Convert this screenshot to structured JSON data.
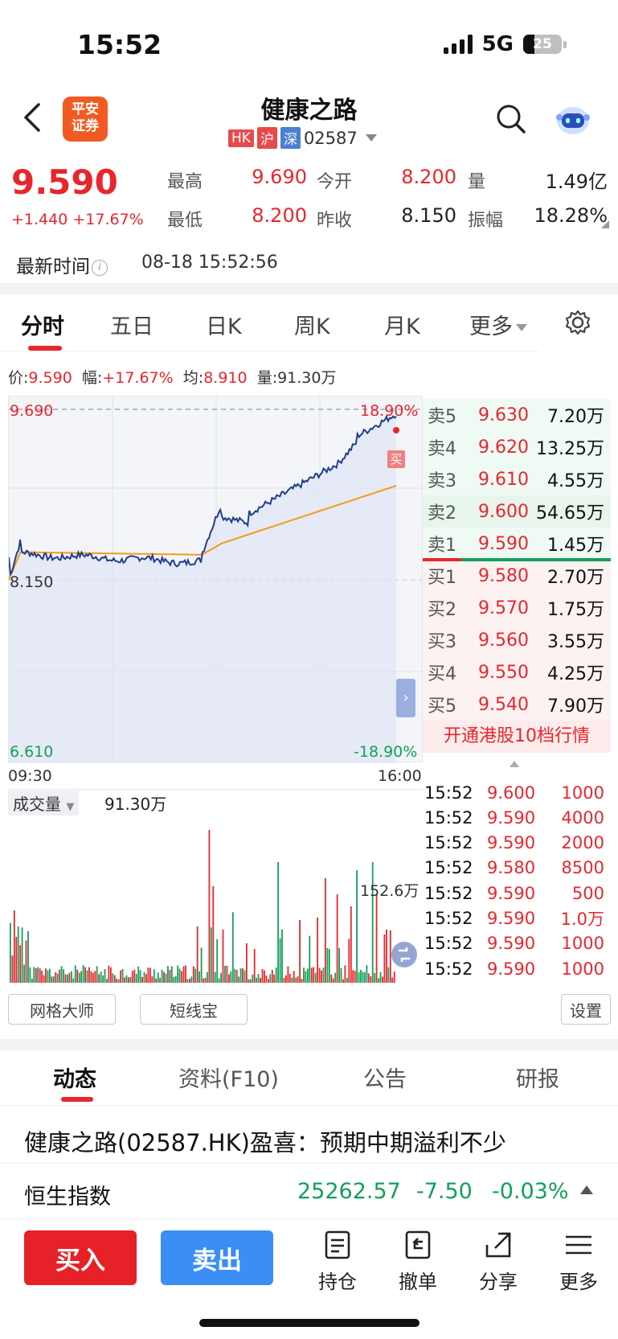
{
  "status": {
    "time": "15:52",
    "network": "5G",
    "battery": "25"
  },
  "header": {
    "logo_line1": "平安",
    "logo_line2": "证券",
    "title": "健康之路",
    "tags": [
      "HK",
      "沪",
      "深"
    ],
    "code": "02587"
  },
  "quote": {
    "price": "9.590",
    "change": "+1.440 +17.67%",
    "high_label": "最高",
    "high": "9.690",
    "open_label": "今开",
    "open": "8.200",
    "vol_label": "量",
    "volume": "1.49亿",
    "low_label": "最低",
    "low": "8.200",
    "prev_label": "昨收",
    "prev_close": "8.150",
    "amp_label": "振幅",
    "amplitude": "18.28%",
    "time_label": "最新时间",
    "time_value": "08-18 15:52:56"
  },
  "chart_tabs": [
    "分时",
    "五日",
    "日K",
    "周K",
    "月K",
    "更多"
  ],
  "stat_line": {
    "price_label": "价:",
    "price": "9.590",
    "pct_label": "幅:",
    "pct": "+17.67%",
    "avg_label": "均:",
    "avg": "8.910",
    "vol_label": "量:",
    "vol": "91.30万"
  },
  "chart_labels": {
    "top_left": "9.690",
    "top_right": "18.90%",
    "mid_left": "8.150",
    "bottom_left": "6.610",
    "bottom_right": "-18.90%",
    "time_start": "09:30",
    "time_end": "16:00",
    "buy_marker": "买",
    "vol_label": "成交量",
    "vol_value": "91.30万",
    "vol_peak": "152.6万"
  },
  "colors": {
    "red": "#e8262c",
    "green": "#12a05a",
    "blue": "#3a8ef5",
    "price_line": "#1f3e8c",
    "avg_line": "#f39a1d"
  },
  "order_book": {
    "asks": [
      {
        "label": "卖5",
        "price": "9.630",
        "vol": "7.20万"
      },
      {
        "label": "卖4",
        "price": "9.620",
        "vol": "13.25万"
      },
      {
        "label": "卖3",
        "price": "9.610",
        "vol": "4.55万"
      },
      {
        "label": "卖2",
        "price": "9.600",
        "vol": "54.65万"
      },
      {
        "label": "卖1",
        "price": "9.590",
        "vol": "1.45万"
      }
    ],
    "bids": [
      {
        "label": "买1",
        "price": "9.580",
        "vol": "2.70万"
      },
      {
        "label": "买2",
        "price": "9.570",
        "vol": "1.75万"
      },
      {
        "label": "买3",
        "price": "9.560",
        "vol": "3.55万"
      },
      {
        "label": "买4",
        "price": "9.550",
        "vol": "4.25万"
      },
      {
        "label": "买5",
        "price": "9.540",
        "vol": "7.90万"
      }
    ],
    "banner": "开通港股10档行情"
  },
  "ticks": [
    {
      "time": "15:52",
      "price": "9.600",
      "vol": "1000"
    },
    {
      "time": "15:52",
      "price": "9.590",
      "vol": "4000"
    },
    {
      "time": "15:52",
      "price": "9.590",
      "vol": "2000"
    },
    {
      "time": "15:52",
      "price": "9.580",
      "vol": "8500"
    },
    {
      "time": "15:52",
      "price": "9.590",
      "vol": "500"
    },
    {
      "time": "15:52",
      "price": "9.590",
      "vol": "1.0万"
    },
    {
      "time": "15:52",
      "price": "9.590",
      "vol": "1000"
    },
    {
      "time": "15:52",
      "price": "9.590",
      "vol": "1000"
    }
  ],
  "tools": {
    "grid": "网格大师",
    "short": "短线宝",
    "settings": "设置"
  },
  "bottom_tabs": [
    "动态",
    "资料(F10)",
    "公告",
    "研报"
  ],
  "news": "健康之路(02587.HK)盈喜：预期中期溢利不少",
  "index": {
    "name": "恒生指数",
    "value": "25262.57",
    "change": "-7.50",
    "pct": "-0.03%"
  },
  "actions": {
    "buy": "买入",
    "sell": "卖出",
    "hold": "持仓",
    "cancel": "撤单",
    "share": "分享",
    "more": "更多"
  }
}
